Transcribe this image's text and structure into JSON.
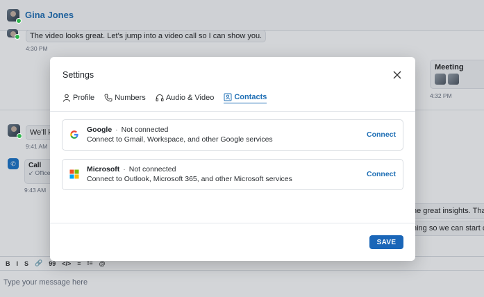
{
  "chat": {
    "contact_name": "Gina Jones",
    "messages": [
      {
        "text": "The video looks great. Let's jump into a video call so I can show you.",
        "time": "4:30 PM"
      },
      {
        "text": "We'll k",
        "time": "9:41 AM"
      },
      {
        "text": "ne great insights. Tha"
      },
      {
        "text": "ning so we can start c"
      }
    ],
    "meeting": {
      "title": "Meeting",
      "time": "4:32 PM"
    },
    "call": {
      "title": "Call",
      "subtitle": "↙ Office",
      "time": "9:43 AM"
    },
    "composer": {
      "toolbar": [
        "B",
        "I",
        "S",
        "🔗",
        "99",
        "</>",
        "≡",
        "⁝≡",
        "@"
      ],
      "placeholder": "Type your message here"
    }
  },
  "settings": {
    "title": "Settings",
    "tabs": [
      {
        "label": "Profile",
        "icon": "person-icon",
        "active": false
      },
      {
        "label": "Numbers",
        "icon": "phone-icon",
        "active": false
      },
      {
        "label": "Audio & Video",
        "icon": "headphones-icon",
        "active": false
      },
      {
        "label": "Contacts",
        "icon": "contacts-icon",
        "active": true
      }
    ],
    "integrations": [
      {
        "name": "Google",
        "status": "Not connected",
        "description": "Connect to Gmail, Workspace, and other Google services",
        "action": "Connect",
        "icon": "google-logo-icon"
      },
      {
        "name": "Microsoft",
        "status": "Not connected",
        "description": "Connect to Outlook, Microsoft 365, and other Microsoft services",
        "action": "Connect",
        "icon": "microsoft-logo-icon"
      }
    ],
    "save_label": "SAVE",
    "colors": {
      "accent": "#1f6fb5",
      "button": "#1a66b8"
    }
  }
}
